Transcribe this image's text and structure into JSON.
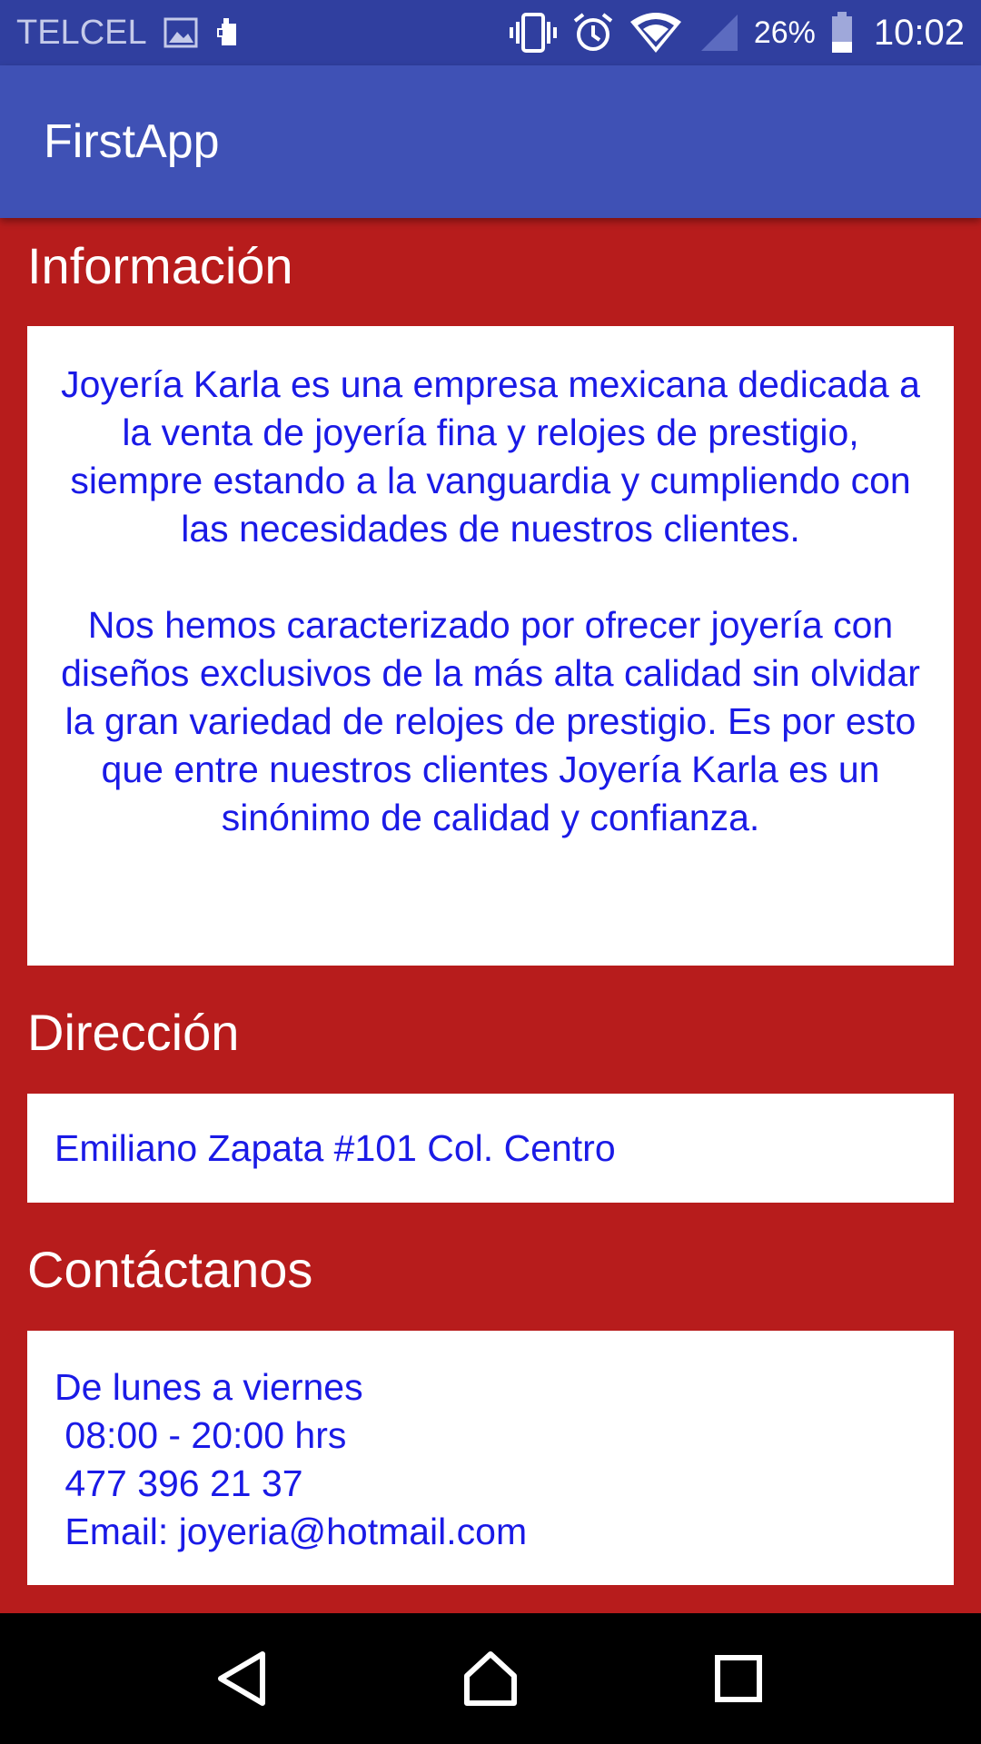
{
  "status_bar": {
    "carrier": "TELCEL",
    "battery_percent": "26%",
    "time": "10:02",
    "icons": [
      "image-icon",
      "sim-icon",
      "vibrate-icon",
      "alarm-icon",
      "wifi-icon",
      "signal-icon",
      "battery-icon"
    ]
  },
  "app_bar": {
    "title": "FirstApp",
    "color": "#3f51b5"
  },
  "theme": {
    "background": "#b71c1c",
    "text_color": "#1a1ae6"
  },
  "sections": {
    "informacion": {
      "title": "Información",
      "paragraphs": [
        "Joyería Karla es una empresa mexicana dedicada a la venta de joyería fina y relojes de prestigio, siempre estando a la vanguardia y cumpliendo con las necesidades de nuestros clientes.",
        "Nos hemos caracterizado por ofrecer joyería con diseños exclusivos de la más alta calidad sin olvidar la gran variedad de relojes de prestigio. Es por esto que entre nuestros clientes Joyería Karla es un sinónimo de calidad y confianza."
      ]
    },
    "direccion": {
      "title": "Dirección",
      "address": "Emiliano Zapata #101 Col. Centro"
    },
    "contactanos": {
      "title": "Contáctanos",
      "lines": [
        "De lunes a viernes",
        " 08:00 - 20:00 hrs",
        " 477 396 21 37",
        " Email: joyeria@hotmail.com"
      ]
    }
  },
  "nav_bar": {
    "buttons": [
      "back-icon",
      "home-icon",
      "recents-icon"
    ]
  }
}
